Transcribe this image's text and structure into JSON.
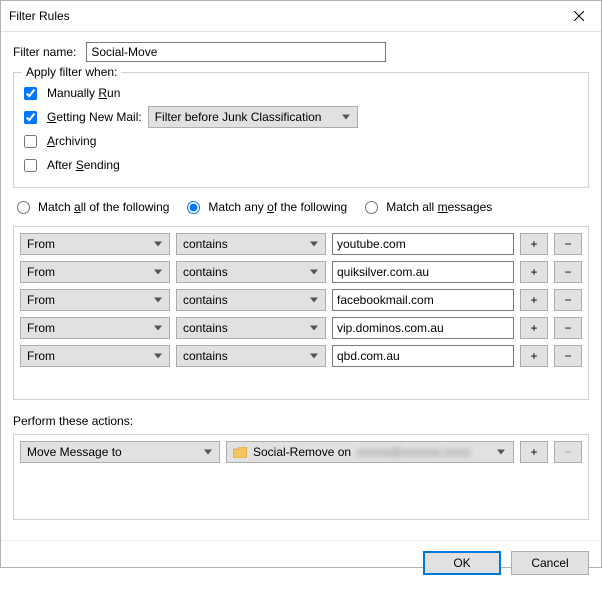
{
  "window": {
    "title": "Filter Rules"
  },
  "filter_name": {
    "label": "Filter name:",
    "value": "Social-Move"
  },
  "apply_when": {
    "legend": "Apply filter when:",
    "manually_run": {
      "label_pre": "Manually ",
      "label_u": "R",
      "label_post": "un",
      "checked": true
    },
    "getting_new_mail": {
      "label_u": "G",
      "label_post": "etting New Mail:",
      "checked": true,
      "select_value": "Filter before Junk Classification"
    },
    "archiving": {
      "label_u": "A",
      "label_post": "rchiving",
      "checked": false
    },
    "after_sending": {
      "label_pre": "After ",
      "label_u": "S",
      "label_post": "ending",
      "checked": false
    }
  },
  "match_mode": {
    "all_label_pre": "Match ",
    "all_label_u": "a",
    "all_label_post": "ll of the following",
    "any_label_pre": "Match any ",
    "any_label_u": "o",
    "any_label_post": "f the following",
    "msgs_label_pre": "Match all ",
    "msgs_label_u": "m",
    "msgs_label_post": "essages",
    "selected": "any"
  },
  "rules": [
    {
      "field": "From",
      "cond": "contains",
      "value": "youtube.com"
    },
    {
      "field": "From",
      "cond": "contains",
      "value": "quiksilver.com.au"
    },
    {
      "field": "From",
      "cond": "contains",
      "value": "facebookmail.com"
    },
    {
      "field": "From",
      "cond": "contains",
      "value": "vip.dominos.com.au"
    },
    {
      "field": "From",
      "cond": "contains",
      "value": "qbd.com.au"
    }
  ],
  "rule_buttons": {
    "add": "+",
    "remove": "−"
  },
  "actions_label": "Perform these actions:",
  "actions": [
    {
      "type": "Move Message to",
      "target_prefix": "Social-Remove on",
      "target_blur": "xxxxxx@xxxxxxx.xxxxx",
      "remove_disabled": true
    }
  ],
  "footer": {
    "ok": "OK",
    "cancel": "Cancel"
  }
}
